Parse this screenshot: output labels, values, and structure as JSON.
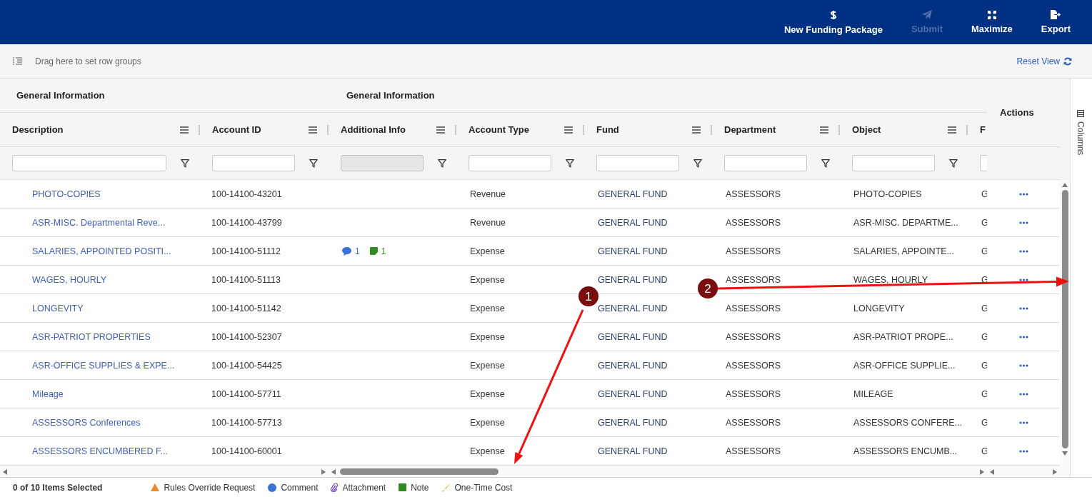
{
  "toolbar": {
    "buttons": [
      {
        "label": "New Funding Package",
        "disabled": false
      },
      {
        "label": "Submit",
        "disabled": true
      },
      {
        "label": "Maximize",
        "disabled": false
      },
      {
        "label": "Export",
        "disabled": false
      }
    ]
  },
  "row_group_bar": {
    "drop_hint": "Drag here to set row groups",
    "reset_label": "Reset View"
  },
  "grid": {
    "groups": [
      {
        "label": "General Information"
      },
      {
        "label": "General Information"
      }
    ],
    "actions_label": "Actions",
    "columns": [
      {
        "label": "Description"
      },
      {
        "label": "Account ID"
      },
      {
        "label": "Additional Info",
        "filter_disabled": true
      },
      {
        "label": "Account Type"
      },
      {
        "label": "Fund"
      },
      {
        "label": "Department"
      },
      {
        "label": "Object"
      },
      {
        "label": "F"
      }
    ],
    "rows": [
      {
        "description": "PHOTO-COPIES",
        "account_id": "100-14100-43201",
        "account_type": "Revenue",
        "fund": "GENERAL FUND",
        "department": "ASSESSORS",
        "object": "PHOTO-COPIES",
        "column_8": "G"
      },
      {
        "description": "ASR-MISC. Departmental Reve...",
        "account_id": "100-14100-43799",
        "account_type": "Revenue",
        "fund": "GENERAL FUND",
        "department": "ASSESSORS",
        "object": "ASR-MISC. DEPARTME...",
        "column_8": "G"
      },
      {
        "description": "SALARIES, APPOINTED POSITI...",
        "account_id": "100-14100-51112",
        "additional_info": {
          "comments": "1",
          "notes": "1"
        },
        "account_type": "Expense",
        "fund": "GENERAL FUND",
        "department": "ASSESSORS",
        "object": "SALARIES, APPOINTE...",
        "column_8": "G"
      },
      {
        "description": "WAGES, HOURLY",
        "account_id": "100-14100-51113",
        "account_type": "Expense",
        "fund": "GENERAL FUND",
        "department": "ASSESSORS",
        "object": "WAGES, HOURLY",
        "column_8": "G"
      },
      {
        "description": "LONGEVITY",
        "account_id": "100-14100-51142",
        "account_type": "Expense",
        "fund": "GENERAL FUND",
        "department": "ASSESSORS",
        "object": "LONGEVITY",
        "column_8": "G"
      },
      {
        "description": "ASR-PATRIOT PROPERTIES",
        "account_id": "100-14100-52307",
        "account_type": "Expense",
        "fund": "GENERAL FUND",
        "department": "ASSESSORS",
        "object": "ASR-PATRIOT PROPE...",
        "column_8": "G"
      },
      {
        "description": "ASR-OFFICE SUPPLIES & EXPE...",
        "account_id": "100-14100-54425",
        "account_type": "Expense",
        "fund": "GENERAL FUND",
        "department": "ASSESSORS",
        "object": "ASR-OFFICE SUPPLIE...",
        "column_8": "G"
      },
      {
        "description": "Mileage",
        "account_id": "100-14100-57711",
        "account_type": "Expense",
        "fund": "GENERAL FUND",
        "department": "ASSESSORS",
        "object": "MILEAGE",
        "column_8": "G"
      },
      {
        "description": "ASSESSORS Conferences",
        "account_id": "100-14100-57713",
        "account_type": "Expense",
        "fund": "GENERAL FUND",
        "department": "ASSESSORS",
        "object": "ASSESSORS CONFERE...",
        "column_8": "G"
      },
      {
        "description": "ASSESSORS ENCUMBERED F...",
        "account_id": "100-14100-60001",
        "account_type": "Expense",
        "fund": "GENERAL FUND",
        "department": "ASSESSORS",
        "object": "ASSESSORS ENCUMB...",
        "column_8": "G"
      }
    ]
  },
  "side_panel": {
    "label": "Columns"
  },
  "status_bar": {
    "selection": "0 of 10 Items Selected",
    "legend": [
      {
        "label": "Rules Override Request"
      },
      {
        "label": "Comment"
      },
      {
        "label": "Attachment"
      },
      {
        "label": "Note"
      },
      {
        "label": "One-Time Cost"
      }
    ]
  },
  "annotations": [
    {
      "label": "1"
    },
    {
      "label": "2"
    }
  ]
}
